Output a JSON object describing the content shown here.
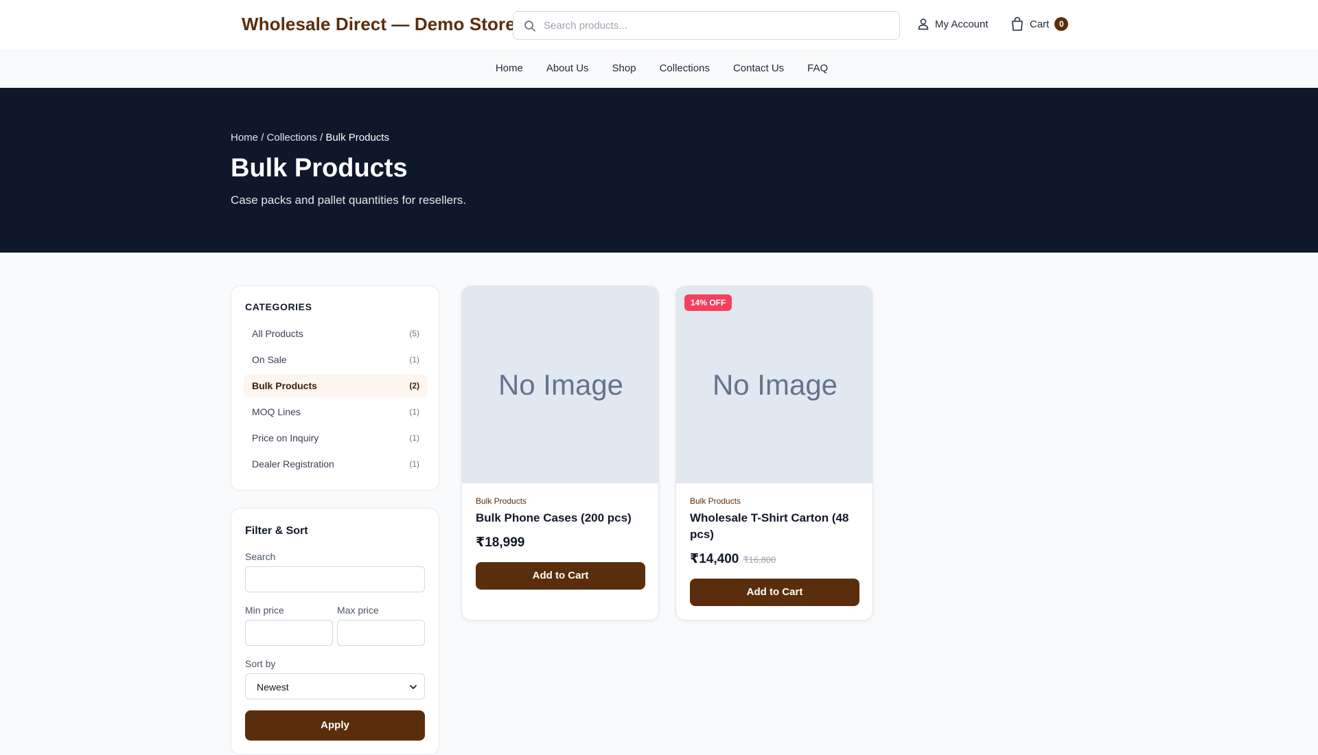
{
  "header": {
    "brand": "Wholesale Direct — Demo Store",
    "search_placeholder": "Search products...",
    "account_label": "My Account",
    "cart_label": "Cart",
    "cart_count": "0"
  },
  "nav": [
    "Home",
    "About Us",
    "Shop",
    "Collections",
    "Contact Us",
    "FAQ"
  ],
  "hero": {
    "breadcrumb": [
      "Home",
      "Collections",
      "Bulk Products"
    ],
    "separator": "/",
    "title": "Bulk Products",
    "subtitle": "Case packs and pallet quantities for resellers."
  },
  "categories": {
    "heading": "CATEGORIES",
    "items": [
      {
        "label": "All Products",
        "count": "(5)"
      },
      {
        "label": "On Sale",
        "count": "(1)"
      },
      {
        "label": "Bulk Products",
        "count": "(2)",
        "active": true
      },
      {
        "label": "MOQ Lines",
        "count": "(1)"
      },
      {
        "label": "Price on Inquiry",
        "count": "(1)"
      },
      {
        "label": "Dealer Registration",
        "count": "(1)"
      }
    ]
  },
  "filters": {
    "heading": "Filter & Sort",
    "search_label": "Search",
    "min_label": "Min price",
    "max_label": "Max price",
    "sort_label": "Sort by",
    "sort_value": "Newest",
    "apply_label": "Apply"
  },
  "products": [
    {
      "image_text": "No Image",
      "category": "Bulk Products",
      "name": "Bulk Phone Cases (200 pcs)",
      "price": "₹18,999",
      "button": "Add to Cart"
    },
    {
      "image_text": "No Image",
      "badge": "14% OFF",
      "category": "Bulk Products",
      "name": "Wholesale T-Shirt Carton (48 pcs)",
      "price": "₹14,400",
      "old_price": "₹16,800",
      "button": "Add to Cart"
    }
  ],
  "colors": {
    "brand": "#5a2e0c",
    "hero_bg": "#0f172a",
    "badge": "#f43f5e"
  }
}
